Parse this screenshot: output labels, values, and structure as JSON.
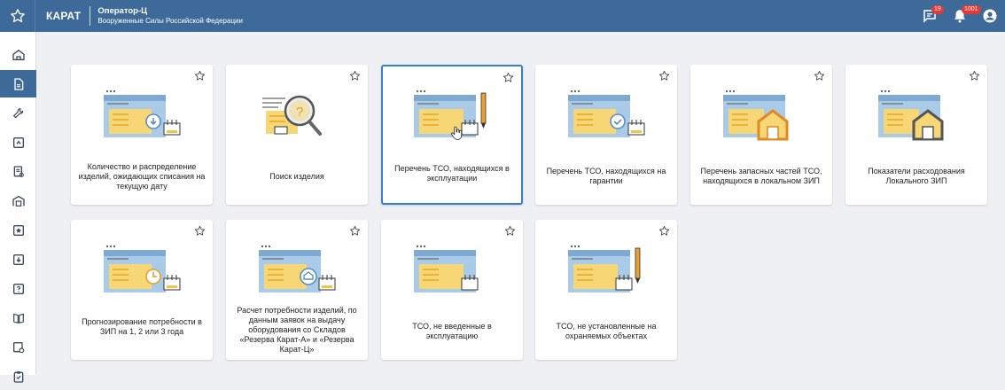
{
  "header": {
    "brand": "КАРАТ",
    "role_title": "Оператор-Ц",
    "organization": "Вооруженные Силы Российской Федерации",
    "messages_count": "19",
    "notifications_count": "1001"
  },
  "sidebar": {
    "items": [
      {
        "icon": "home-icon"
      },
      {
        "icon": "document-icon"
      },
      {
        "icon": "wrench-icon"
      },
      {
        "icon": "arrow-box-icon"
      },
      {
        "icon": "report-icon"
      },
      {
        "icon": "warehouse-icon"
      },
      {
        "icon": "star-box-icon"
      },
      {
        "icon": "download-box-icon"
      },
      {
        "icon": "question-box-icon"
      },
      {
        "icon": "book-icon"
      },
      {
        "icon": "settings-doc-icon"
      },
      {
        "icon": "clipboard-icon"
      }
    ]
  },
  "cards": [
    {
      "label": "Количество и распределение изделий, ожидающих списания на текущую дату"
    },
    {
      "label": "Поиск изделия"
    },
    {
      "label": "Перечень ТСО, находящихся в эксплуатации"
    },
    {
      "label": "Перечень ТСО, находящихся на гарантии"
    },
    {
      "label": "Перечень запасных частей ТСО, находящихся в локальном ЗИП"
    },
    {
      "label": "Показатели расходования Локального ЗИП"
    },
    {
      "label": "Прогнозирование потребности в ЗИП на 1, 2 или 3 года"
    },
    {
      "label": "Расчет потребности изделий, по данным заявок на выдачу оборудования со Складов «Резерва Карат-А» и «Резерва Карат-Ц»"
    },
    {
      "label": "ТСО, не введенные в эксплуатацию"
    },
    {
      "label": "ТСО, не установленные на охраняемых объектах"
    }
  ],
  "colors": {
    "topbar": "#3d6a99",
    "sidebar_active": "#3d6a99",
    "selected_border": "#3d7cc9",
    "illus_blue": "#a9cbe8",
    "illus_yellow": "#f7d676",
    "badge": "#e53935"
  }
}
